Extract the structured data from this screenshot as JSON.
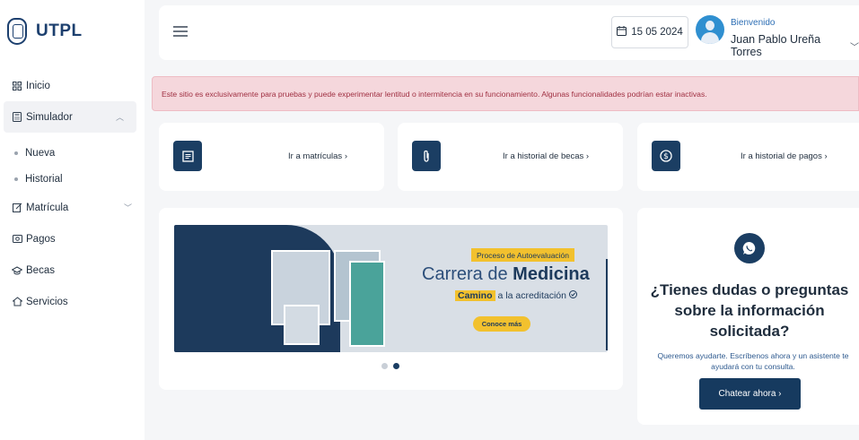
{
  "brand": {
    "logo_text": "UTPL"
  },
  "sidebar": {
    "items": [
      {
        "label": "Inicio",
        "icon": "grid-icon"
      },
      {
        "label": "Simulador",
        "icon": "calculator-icon",
        "expanded": true
      },
      {
        "label": "Nueva"
      },
      {
        "label": "Historial"
      },
      {
        "label": "Matrícula",
        "icon": "edit-icon"
      },
      {
        "label": "Pagos",
        "icon": "money-icon"
      },
      {
        "label": "Becas",
        "icon": "graduation-icon"
      },
      {
        "label": "Servicios",
        "icon": "home-icon"
      }
    ]
  },
  "header": {
    "date": "15 05 2024",
    "welcome": "Bienvenido",
    "user_name": "Juan Pablo Ureña Torres"
  },
  "alert": {
    "text": "Este sitio es exclusivamente para pruebas y puede experimentar lentitud o intermitencia en su funcionamiento. Algunas funcionalidades podrían estar inactivas."
  },
  "quick_links": [
    {
      "label": "Ir a matrículas ›",
      "icon": "document-icon"
    },
    {
      "label": "Ir a historial de becas ›",
      "icon": "paperclip-icon"
    },
    {
      "label": "Ir a historial de pagos ›",
      "icon": "dollar-icon"
    }
  ],
  "banner": {
    "tag": "Proceso de Autoevaluación",
    "title_prefix": "Carrera de",
    "title_bold": "Medicina",
    "sub_highlight": "Camino",
    "sub_rest": "a la acreditación",
    "cta": "Conoce más",
    "slides": 2,
    "active_slide": 2
  },
  "help": {
    "question": "¿Tienes dudas o preguntas sobre la información solicitada?",
    "text": "Queremos ayudarte. Escríbenos ahora y un asistente te ayudará con tu consulta.",
    "button": "Chatear ahora ›"
  },
  "colors": {
    "primary": "#1b3e63",
    "accent_yellow": "#f2c12e",
    "alert_bg": "#f5d7dc",
    "alert_text": "#a03042"
  }
}
